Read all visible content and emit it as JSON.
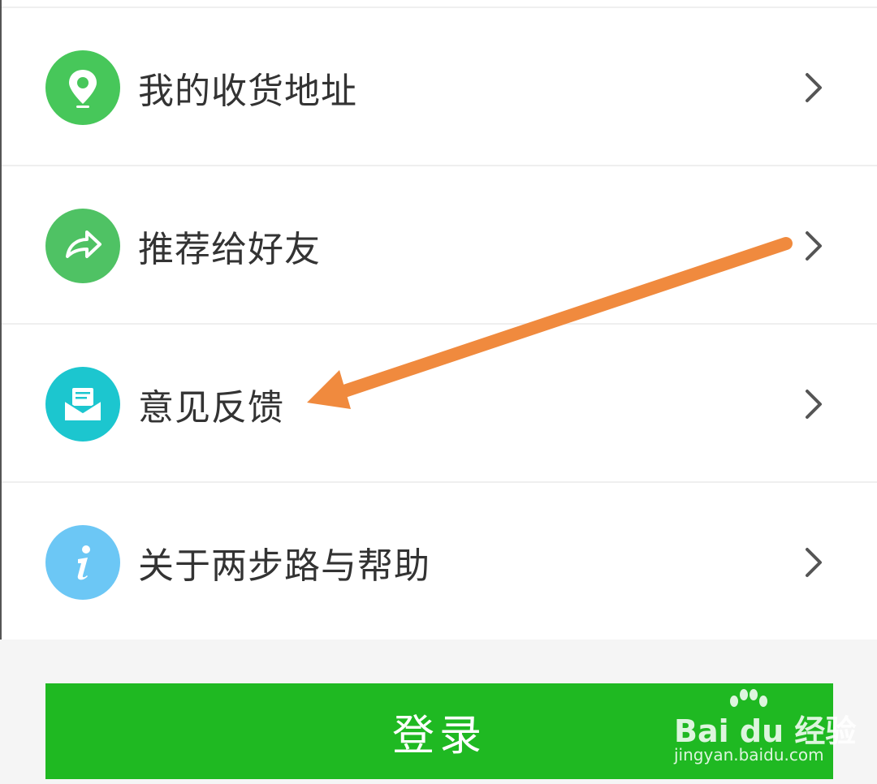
{
  "menu": {
    "items": [
      {
        "label": "我的收货地址",
        "icon": "location-pin-icon",
        "icon_color": "#47c75a"
      },
      {
        "label": "推荐给好友",
        "icon": "share-arrow-icon",
        "icon_color": "#4fc264"
      },
      {
        "label": "意见反馈",
        "icon": "mail-envelope-icon",
        "icon_color": "#1cc6cf"
      },
      {
        "label": "关于两步路与帮助",
        "icon": "info-icon",
        "icon_color": "#6cc7f5"
      }
    ]
  },
  "login": {
    "label": "登录",
    "color": "#1fb922"
  },
  "annotation": {
    "arrow_color": "#f08a3e",
    "points_to": "意见反馈"
  },
  "watermark": {
    "brand": "Bai du 经验",
    "url": "jingyan.baidu.com"
  }
}
